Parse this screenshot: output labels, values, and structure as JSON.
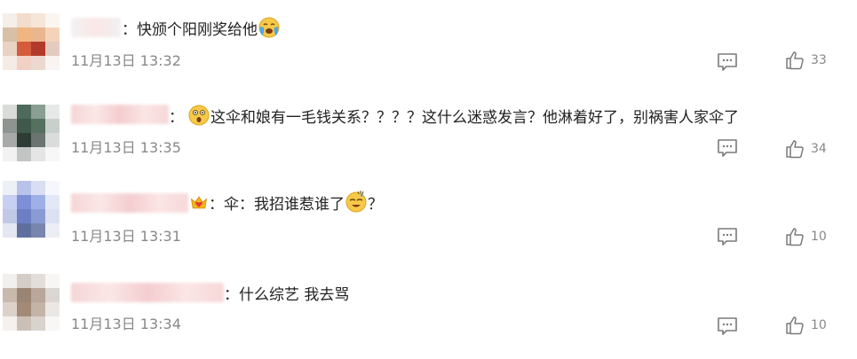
{
  "comments": [
    {
      "separator": "：",
      "text": "快颁个阳刚奖给他",
      "emoji_after": "crying-face-icon",
      "time": "11月13日 13:32",
      "likes": "33"
    },
    {
      "separator": "：",
      "emoji_before": "surprised-face-icon",
      "text": "这伞和娘有一毛钱关系？？？？这什么迷惑发言？他淋着好了，别祸害人家伞了",
      "time": "11月13日 13:35",
      "likes": "34"
    },
    {
      "badge": "crown-heart-badge-icon",
      "separator": "：",
      "text": "伞：我招谁惹谁了",
      "emoji_after": "sweat-smile-face-icon",
      "text_after": "？",
      "time": "11月13日 13:31",
      "likes": "10"
    },
    {
      "separator": "：",
      "text": "什么综艺 我去骂",
      "time": "11月13日 13:34",
      "likes": "10"
    }
  ],
  "colors": {
    "text": "#222222",
    "meta": "#888888",
    "name_redaction": "#f6d5d6"
  }
}
